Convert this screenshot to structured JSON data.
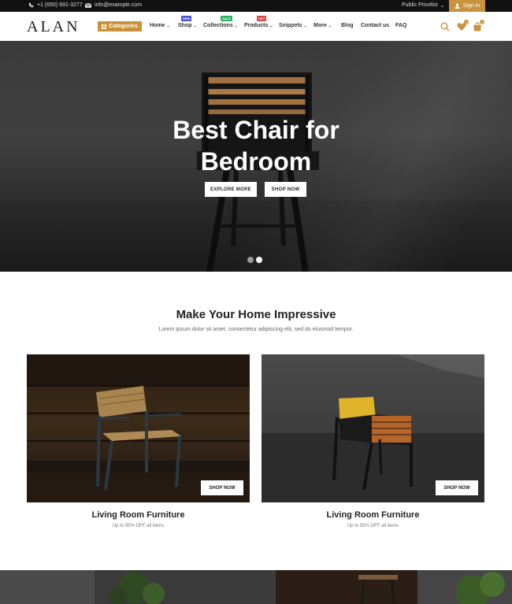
{
  "topbar": {
    "phone": "+1 (650) 691-3277",
    "email": "info@example.com",
    "pricelist": "Public Pricelist",
    "signin": "Sign in"
  },
  "header": {
    "logo": "ALAN",
    "categories": "Categories",
    "nav": [
      {
        "label": "Home",
        "chevron": true
      },
      {
        "label": "Shop",
        "chevron": true,
        "badge": "NEW",
        "badge_color": "#4a4fd6"
      },
      {
        "label": "Collections",
        "chevron": true,
        "badge": "SALE",
        "badge_color": "#28b463"
      },
      {
        "label": "Products",
        "chevron": true,
        "badge": "HOT",
        "badge_color": "#e0404a"
      },
      {
        "label": "Snippets",
        "chevron": true
      },
      {
        "label": "More",
        "chevron": true
      },
      {
        "label": "Blog",
        "chevron": false
      },
      {
        "label": "Contact us",
        "chevron": false
      },
      {
        "label": "FAQ",
        "chevron": false
      }
    ],
    "wishlist_count": "0",
    "cart_count": "0"
  },
  "hero": {
    "title_line1": "Best Chair for",
    "title_line2": "Bedroom",
    "explore_button": "EXPLORE MORE",
    "shop_button": "SHOP NOW",
    "slides": 2,
    "active_slide": 2
  },
  "section": {
    "title": "Make Your Home Impressive",
    "subtitle": "Lorem ipsum dolor sit amet, consectetur adipiscing elit, sed do eiusmod tempor."
  },
  "cards": [
    {
      "title": "Living Room Furniture",
      "subtitle": "Up to 55% OFF all items",
      "button": "SHOP NOW"
    },
    {
      "title": "Living Room Furniture",
      "subtitle": "Up to 55% OFF all items",
      "button": "SHOP NOW"
    }
  ],
  "colors": {
    "accent": "#c9933e",
    "topbar_bg": "#111111"
  },
  "icons": [
    "phone-icon",
    "mail-icon",
    "user-icon",
    "grid-icon",
    "search-icon",
    "heart-icon",
    "bag-icon"
  ]
}
